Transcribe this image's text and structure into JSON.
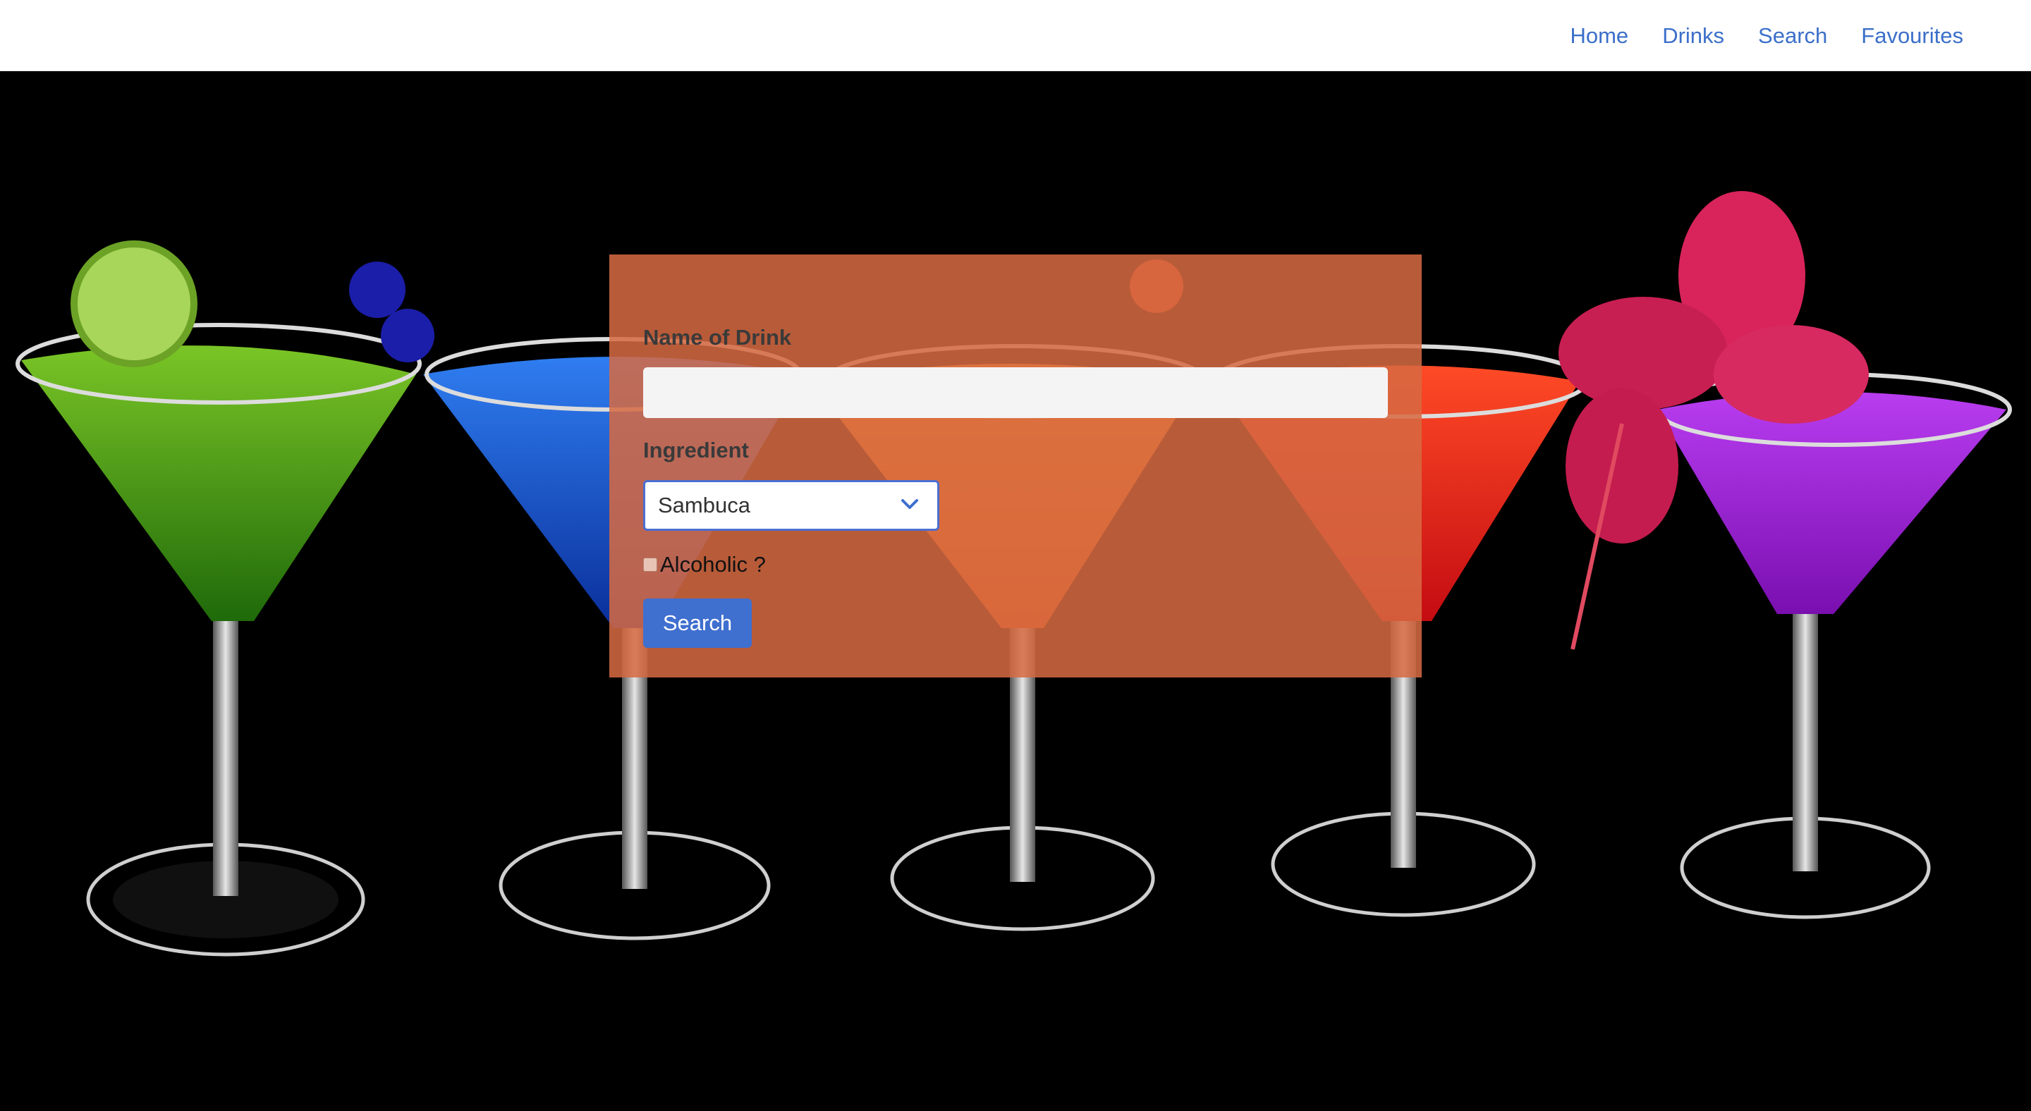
{
  "nav": {
    "links": [
      "Home",
      "Drinks",
      "Search",
      "Favourites"
    ]
  },
  "search_form": {
    "name_label": "Name of Drink",
    "name_value": "",
    "ingredient_label": "Ingredient",
    "ingredient_selected": "Sambuca",
    "alcoholic_label": "Alcoholic ?",
    "alcoholic_checked": false,
    "submit_label": "Search"
  },
  "colors": {
    "link": "#3b6fc9",
    "panel": "#d66a42",
    "button": "#3f6fcf"
  },
  "hero_image": {
    "subject": "five cocktail glasses with green, blue, orange, red and purple drinks"
  }
}
